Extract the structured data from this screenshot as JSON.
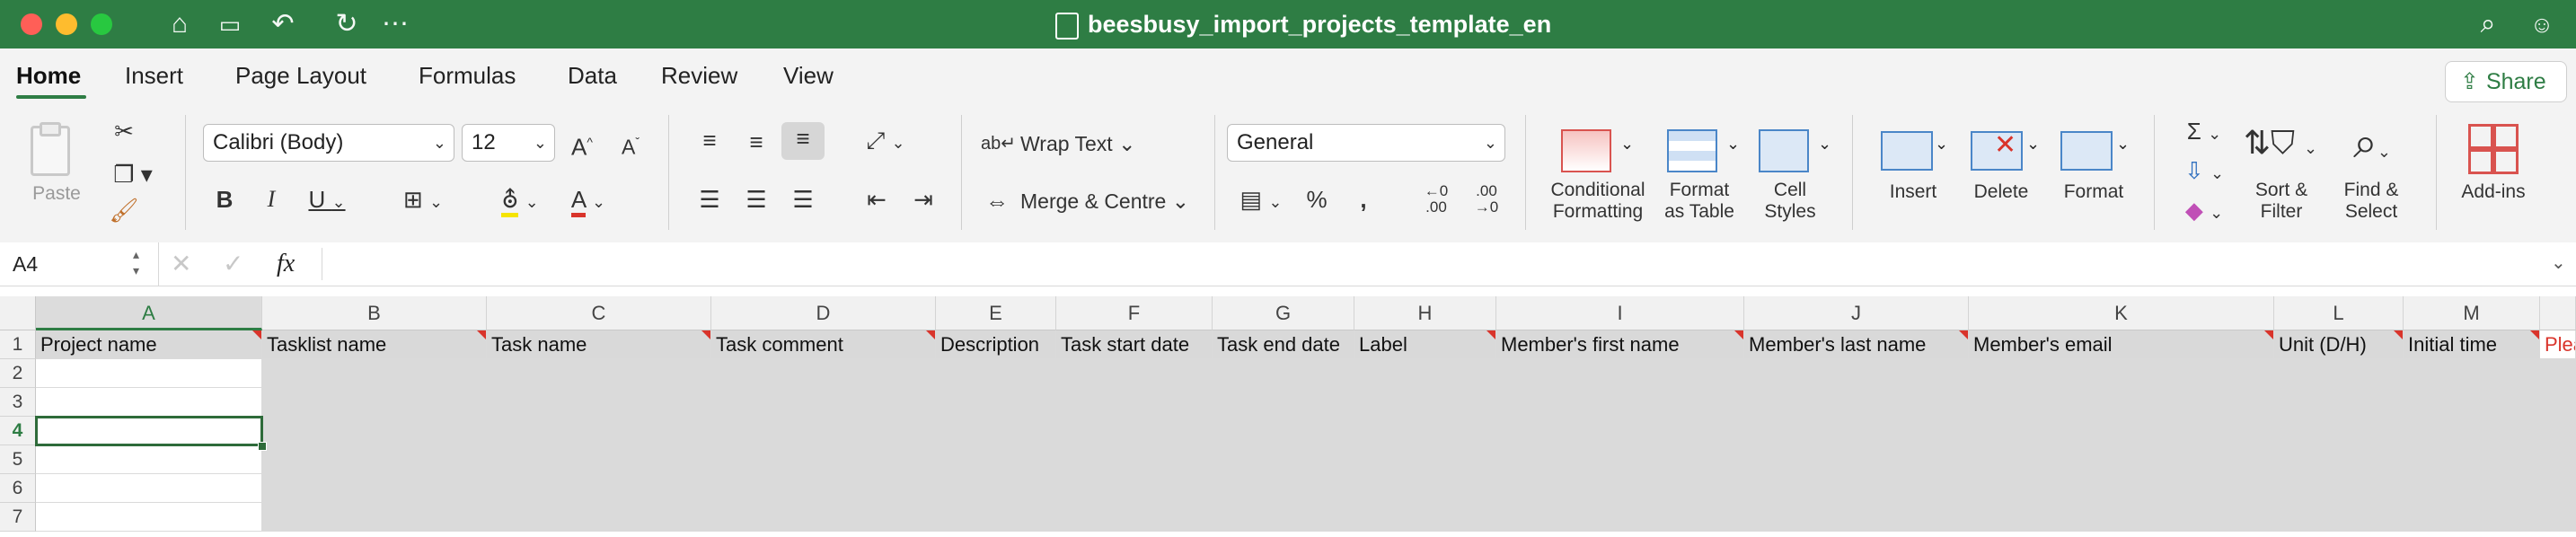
{
  "window": {
    "title": "beesbusy_import_projects_template_en"
  },
  "menu_tabs": [
    "Home",
    "Insert",
    "Page Layout",
    "Formulas",
    "Data",
    "Review",
    "View"
  ],
  "share_label": "Share",
  "ribbon": {
    "paste_label": "Paste",
    "font_name": "Calibri (Body)",
    "font_size": "12",
    "wrap_text": "Wrap Text",
    "merge_centre": "Merge & Centre",
    "number_format": "General",
    "conditional_formatting": [
      "Conditional",
      "Formatting"
    ],
    "format_as_table": [
      "Format",
      "as Table"
    ],
    "cell_styles": [
      "Cell",
      "Styles"
    ],
    "insert": "Insert",
    "delete": "Delete",
    "format": "Format",
    "sort_filter": [
      "Sort &",
      "Filter"
    ],
    "find_select": [
      "Find &",
      "Select"
    ],
    "add_ins": "Add-ins"
  },
  "formula_bar": {
    "name_box": "A4",
    "fx": "fx",
    "formula": ""
  },
  "sheet": {
    "columns": [
      "A",
      "B",
      "C",
      "D",
      "E",
      "F",
      "G",
      "H",
      "I",
      "J",
      "K",
      "L",
      "M"
    ],
    "rows": [
      "1",
      "2",
      "3",
      "4",
      "5",
      "6",
      "7"
    ],
    "selected_cell": "A4",
    "headers": [
      "Project name",
      "Tasklist name",
      "Task name",
      "Task comment",
      "Description",
      "Task start date",
      "Task end date",
      "Label",
      "Member's first name",
      "Member's last name",
      "Member's email",
      "Unit (D/H)",
      "Initial time"
    ],
    "overflow_text": "Plea"
  },
  "colors": {
    "accent": "#2e7d44",
    "header_fill": "#d9d9d9",
    "comment_flag": "#d9342b"
  }
}
